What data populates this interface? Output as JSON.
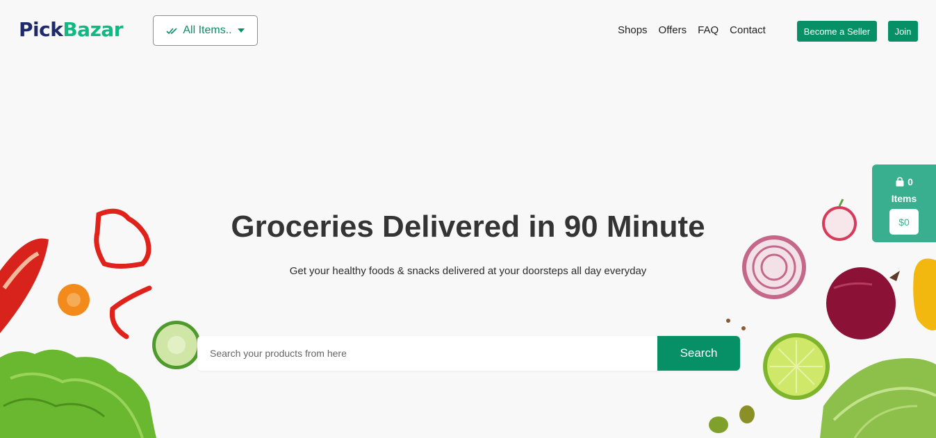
{
  "header": {
    "logo_part1": "Pick",
    "logo_part2": "Bazar",
    "category_label": "All Items..",
    "nav": [
      "Shops",
      "Offers",
      "FAQ",
      "Contact"
    ],
    "become_seller": "Become a Seller",
    "join": "Join"
  },
  "hero": {
    "title": "Groceries Delivered in 90 Minute",
    "subtitle": "Get your healthy foods & snacks delivered at your doorsteps all day everyday",
    "search_placeholder": "Search your products from here",
    "search_button": "Search"
  },
  "cart": {
    "count": "0",
    "items_label": "Items",
    "total": "$0"
  },
  "colors": {
    "brand_green": "#079065",
    "logo_dark": "#1f2a6b",
    "logo_green": "#10b981",
    "cart_green": "#3aaf8f"
  }
}
